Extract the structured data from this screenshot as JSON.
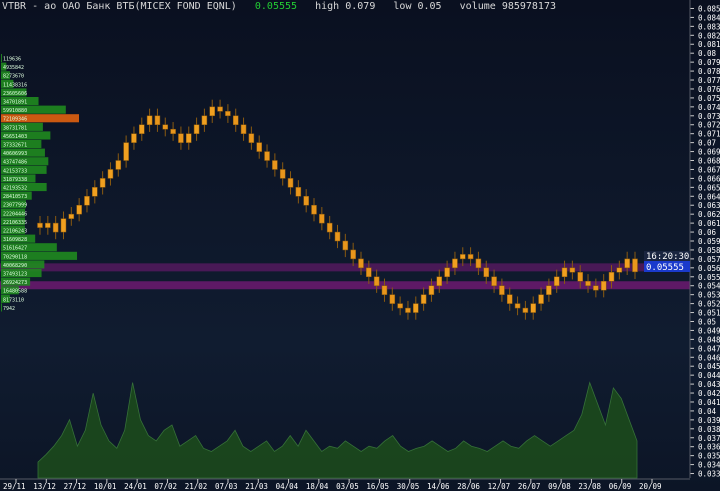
{
  "header": {
    "symbol": "VTBR",
    "name": "ао ОАО Банк ВТБ(MICEX FOND EQNL)",
    "last": "0.05555",
    "high_label": "high",
    "high": "0.079",
    "low_label": "low",
    "low": "0.05",
    "volume_label": "volume",
    "volume": "985978173"
  },
  "price_tags": {
    "time": "16:20:30",
    "last": "0.05555"
  },
  "colors": {
    "background": "#0f1a2e",
    "candle": "#f0a020",
    "candle_outline": "#8a5a10",
    "bar_red": "#cc2020",
    "bar_green": "#22cc33",
    "profile": "#1f8a1f",
    "profile_poc": "#e06010",
    "band": "#7a1a7a",
    "volume_fill": "#1c4a1c",
    "axis_text": "#ffffff",
    "last_tag": "#1a3acc"
  },
  "chart_data": [
    {
      "type": "candlestick",
      "xlabel": "",
      "ylabel": "",
      "ylim": [
        0.0325,
        0.0855
      ],
      "y_ticks": [
        "0.085",
        "0.084",
        "0.083",
        "0.082",
        "0.081",
        "0.08",
        "0.079",
        "0.078",
        "0.077",
        "0.076",
        "0.075",
        "0.074",
        "0.073",
        "0.072",
        "0.071",
        "0.07",
        "0.069",
        "0.068",
        "0.067",
        "0.066",
        "0.065",
        "0.064",
        "0.063",
        "0.062",
        "0.061",
        "0.06",
        "0.059",
        "0.058",
        "0.057",
        "0.056",
        "0.055",
        "0.054",
        "0.053",
        "0.052",
        "0.051",
        "0.05",
        "0.049",
        "0.048",
        "0.047",
        "0.046",
        "0.045",
        "0.044",
        "0.043",
        "0.042",
        "0.041",
        "0.04",
        "0.039",
        "0.038",
        "0.037",
        "0.036",
        "0.035",
        "0.034",
        "0.033"
      ],
      "x_ticks": [
        "29/11",
        "13/12",
        "27/12",
        "10/01",
        "24/01",
        "07/02",
        "21/02",
        "07/03",
        "21/03",
        "04/04",
        "18/04",
        "03/05",
        "16/05",
        "30/05",
        "14/06",
        "28/06",
        "12/07",
        "26/07",
        "09/08",
        "23/08",
        "06/09",
        "20/09"
      ],
      "close": [
        0.0605,
        0.061,
        0.06,
        0.0615,
        0.062,
        0.063,
        0.064,
        0.065,
        0.066,
        0.067,
        0.068,
        0.07,
        0.071,
        0.072,
        0.073,
        0.072,
        0.0715,
        0.071,
        0.07,
        0.071,
        0.072,
        0.073,
        0.074,
        0.0735,
        0.073,
        0.072,
        0.071,
        0.07,
        0.069,
        0.068,
        0.067,
        0.066,
        0.065,
        0.064,
        0.063,
        0.062,
        0.061,
        0.06,
        0.059,
        0.058,
        0.057,
        0.056,
        0.055,
        0.054,
        0.053,
        0.052,
        0.0515,
        0.051,
        0.052,
        0.053,
        0.054,
        0.055,
        0.056,
        0.057,
        0.0575,
        0.057,
        0.056,
        0.055,
        0.054,
        0.053,
        0.052,
        0.0515,
        0.051,
        0.052,
        0.053,
        0.054,
        0.055,
        0.056,
        0.0555,
        0.0545,
        0.054,
        0.0535,
        0.0545,
        0.0555,
        0.056,
        0.057,
        0.05555
      ],
      "volume": [
        0.15,
        0.22,
        0.3,
        0.4,
        0.55,
        0.3,
        0.45,
        0.8,
        0.5,
        0.35,
        0.28,
        0.45,
        0.9,
        0.55,
        0.4,
        0.35,
        0.45,
        0.5,
        0.3,
        0.35,
        0.4,
        0.28,
        0.25,
        0.3,
        0.35,
        0.45,
        0.3,
        0.25,
        0.3,
        0.35,
        0.25,
        0.3,
        0.4,
        0.3,
        0.45,
        0.35,
        0.25,
        0.3,
        0.28,
        0.35,
        0.3,
        0.25,
        0.3,
        0.28,
        0.35,
        0.4,
        0.3,
        0.25,
        0.28,
        0.3,
        0.35,
        0.3,
        0.25,
        0.28,
        0.35,
        0.3,
        0.28,
        0.25,
        0.3,
        0.35,
        0.3,
        0.28,
        0.35,
        0.4,
        0.35,
        0.3,
        0.35,
        0.4,
        0.45,
        0.6,
        0.9,
        0.7,
        0.5,
        0.85,
        0.75,
        0.55,
        0.35
      ]
    },
    {
      "type": "bar",
      "orientation": "horizontal",
      "title": "",
      "labels": [
        "119636",
        "4935842",
        "8273670",
        "11438316",
        "23605606",
        "34701891",
        "59910880",
        "72109346",
        "38731781",
        "45651403",
        "37332671",
        "40606993",
        "43747486",
        "42153733",
        "31879338",
        "42193532",
        "28410573",
        "23077999",
        "22204446",
        "22106335",
        "22106243",
        "31609828",
        "51616427",
        "70290118",
        "40068290",
        "37493123",
        "26924273",
        "16480588",
        "8173110",
        "7942"
      ],
      "values": [
        119636,
        4935842,
        8273670,
        11438316,
        23605606,
        34701891,
        59910880,
        72109346,
        38731781,
        45651403,
        37332671,
        40606993,
        43747486,
        42153733,
        31879338,
        42193532,
        28410573,
        23077999,
        22204446,
        22106335,
        22106243,
        31609828,
        51616427,
        70290118,
        40068290,
        37493123,
        26924273,
        16480588,
        8173110,
        7942
      ]
    }
  ]
}
